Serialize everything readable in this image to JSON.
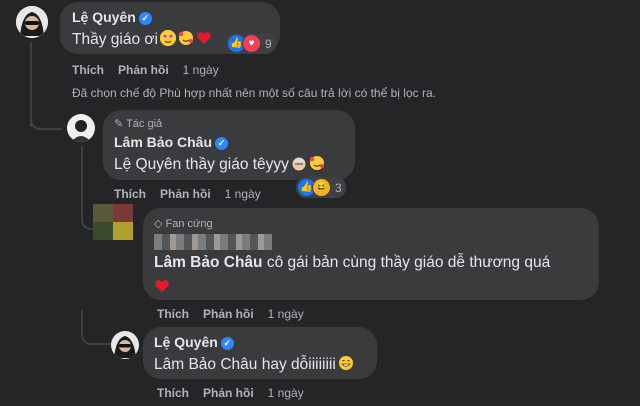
{
  "comments": [
    {
      "author": "Lệ Quyên",
      "text": "Thầy giáo ơi",
      "reaction_count": "9",
      "actions": {
        "like": "Thích",
        "reply": "Phản hồi",
        "time": "1 ngày"
      }
    },
    {
      "badge": "Tác giả",
      "author": "Lâm Bảo Châu",
      "text_prefix": "Lệ Quyên",
      "text": " thầy giáo têyyy",
      "reaction_count": "3",
      "actions": {
        "like": "Thích",
        "reply": "Phản hồi",
        "time": "1 ngày"
      }
    },
    {
      "badge": "Fan cứng",
      "author": "",
      "text_prefix": "Lâm Bảo Châu",
      "text": " cô gái bản cùng thầy giáo dễ thương quá",
      "actions": {
        "like": "Thích",
        "reply": "Phản hồi",
        "time": "1 ngày"
      }
    },
    {
      "author": "Lệ Quyên",
      "text_prefix": "Lâm Bảo Châu",
      "text": " hay dỗiiiiiiii",
      "actions": {
        "like": "Thích",
        "reply": "Phản hồi",
        "time": "1 ngày"
      }
    }
  ],
  "filter_notice": "Đã chọn chế độ Phù hợp nhất nên một số câu trả lời có thể bị lọc ra.",
  "colors": {
    "background": "#242526",
    "bubble": "#3a3b3c",
    "verified": "#2d88ff",
    "like": "#1877f2",
    "love": "#f33e58"
  },
  "icons": [
    "verified-icon",
    "pen-icon",
    "diamond-icon",
    "like-reaction-icon",
    "love-reaction-icon",
    "heart-emoji",
    "star-struck-emoji",
    "smiling-hearts-emoji"
  ]
}
